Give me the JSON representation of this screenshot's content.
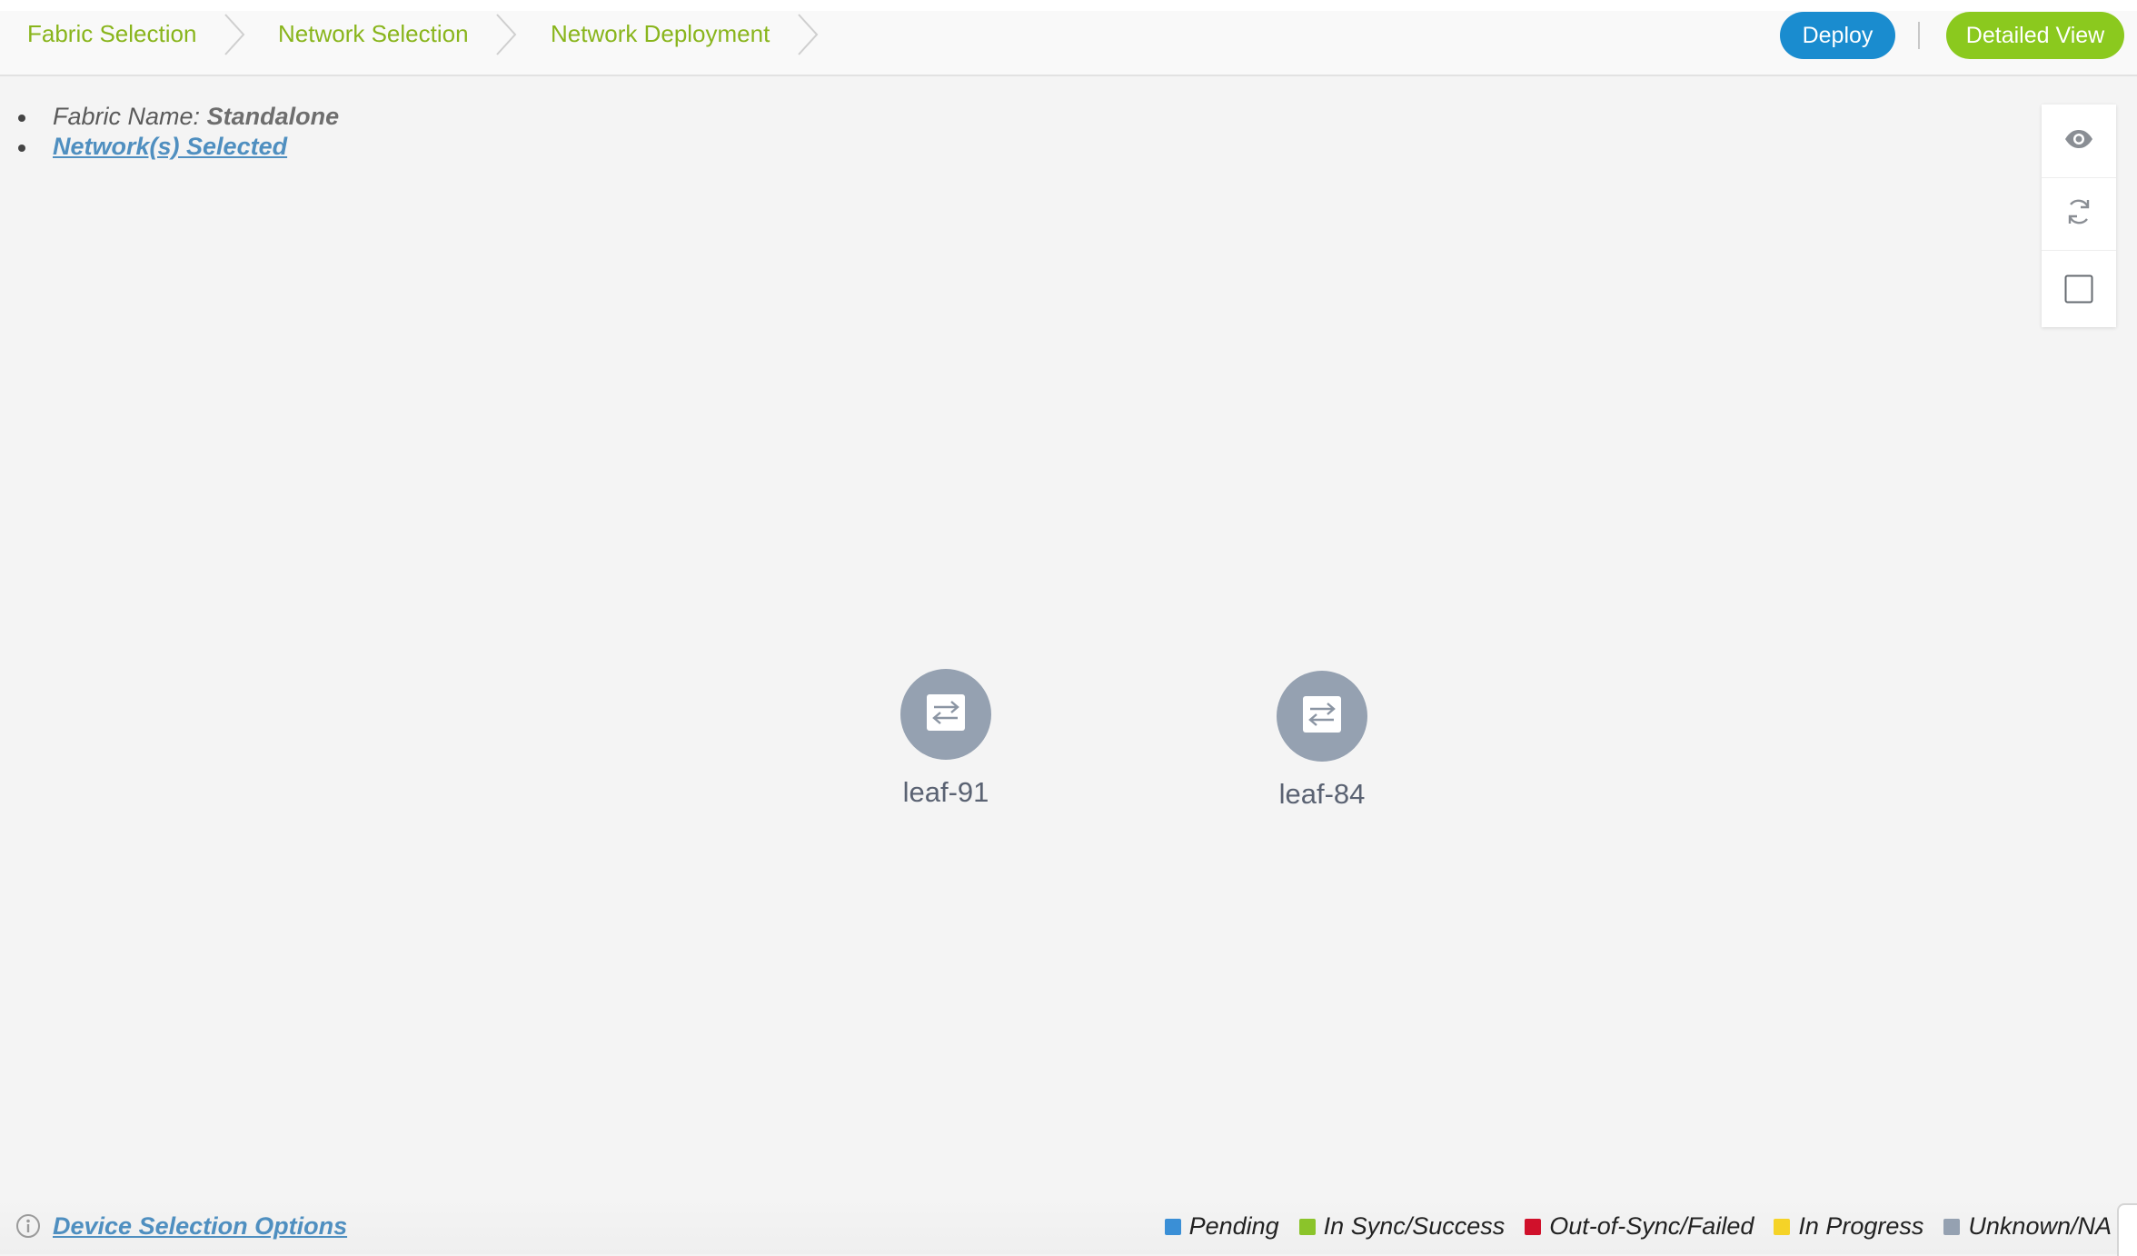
{
  "breadcrumb": {
    "items": [
      {
        "label": "Fabric Selection"
      },
      {
        "label": "Network Selection"
      },
      {
        "label": "Network Deployment"
      }
    ]
  },
  "toolbar": {
    "deploy_label": "Deploy",
    "detailed_view_label": "Detailed View"
  },
  "colors": {
    "accent_green": "#89b51c",
    "deploy_blue": "#1a8ccf",
    "detailed_green": "#8bc91e",
    "node_gray": "#95a1b1"
  },
  "info": {
    "fabric_name_label": "Fabric Name:",
    "fabric_name_value": "Standalone",
    "networks_selected_link": "Network(s) Selected"
  },
  "side_tools": [
    {
      "icon": "eye-icon"
    },
    {
      "icon": "refresh-icon"
    },
    {
      "icon": "checkbox-icon"
    }
  ],
  "topology": {
    "nodes": [
      {
        "name": "leaf-91",
        "icon": "switch-icon"
      },
      {
        "name": "leaf-84",
        "icon": "switch-icon"
      }
    ]
  },
  "footer": {
    "device_selection_link": "Device Selection Options",
    "legend": [
      {
        "label": "Pending",
        "color": "#3a8fd6"
      },
      {
        "label": "In Sync/Success",
        "color": "#8bc42a"
      },
      {
        "label": "Out-of-Sync/Failed",
        "color": "#d0112b"
      },
      {
        "label": "In Progress",
        "color": "#f5d327"
      },
      {
        "label": "Unknown/NA",
        "color": "#95a1b1"
      }
    ]
  }
}
